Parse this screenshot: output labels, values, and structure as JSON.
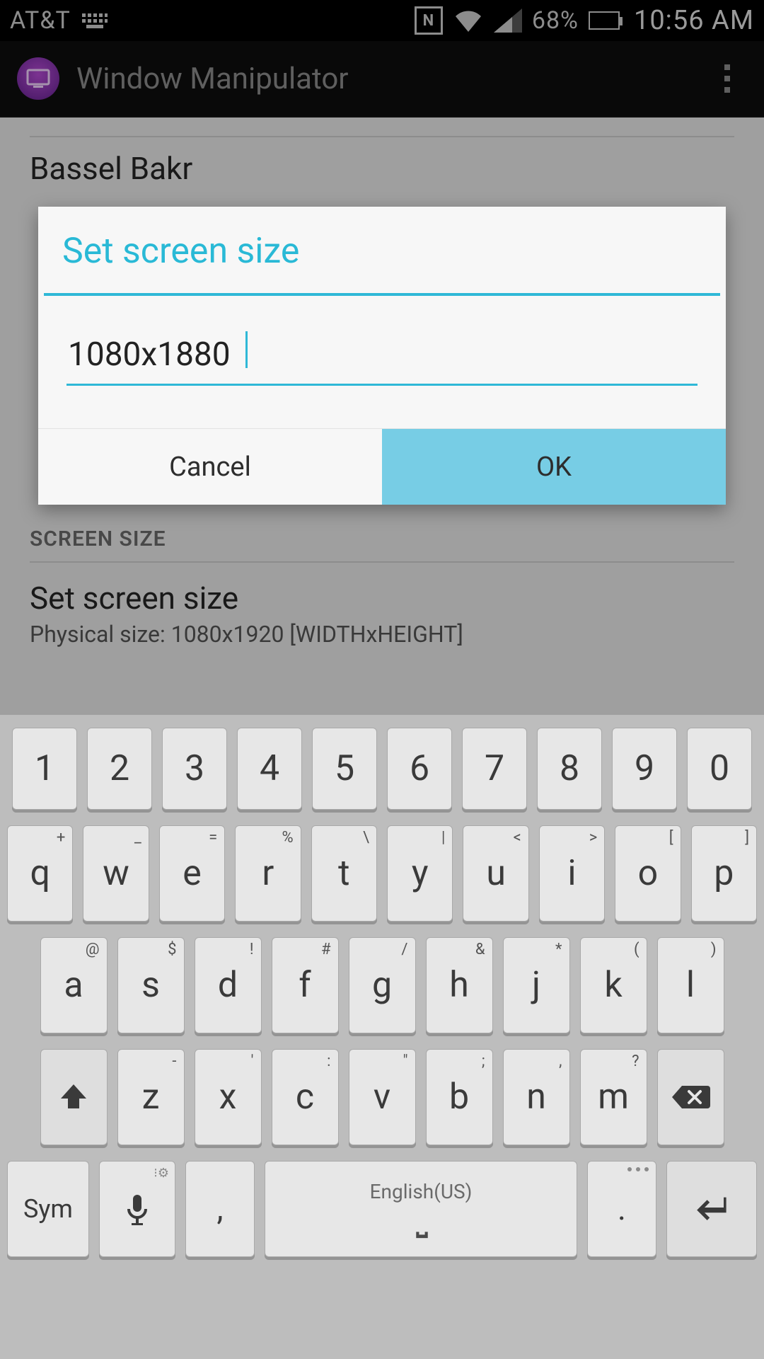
{
  "statusbar": {
    "carrier": "AT&T",
    "battery_pct": "68%",
    "clock": "10:56 AM"
  },
  "actionbar": {
    "title": "Window Manipulator"
  },
  "bg": {
    "author": "Bassel Bakr",
    "section": "SCREEN SIZE",
    "item_title": "Set screen size",
    "item_sub": "Physical size: 1080x1920 [WIDTHxHEIGHT]"
  },
  "dialog": {
    "title": "Set screen size",
    "value": "1080x1880",
    "cancel": "Cancel",
    "ok": "OK"
  },
  "kbd": {
    "nums": [
      "1",
      "2",
      "3",
      "4",
      "5",
      "6",
      "7",
      "8",
      "9",
      "0"
    ],
    "row1_main": [
      "q",
      "w",
      "e",
      "r",
      "t",
      "y",
      "u",
      "i",
      "o",
      "p"
    ],
    "row1_sup": [
      "+",
      "_",
      "=",
      "%",
      "\\",
      "|",
      "<",
      ">",
      "[",
      "]"
    ],
    "row2_main": [
      "a",
      "s",
      "d",
      "f",
      "g",
      "h",
      "j",
      "k",
      "l"
    ],
    "row2_sup": [
      "@",
      "$",
      "!",
      "#",
      "/",
      "&",
      "*",
      "(",
      ")"
    ],
    "row3_main": [
      "z",
      "x",
      "c",
      "v",
      "b",
      "n",
      "m"
    ],
    "row3_sup": [
      "-",
      "'",
      ":",
      "\"",
      ";",
      ",",
      "?"
    ],
    "sym": "Sym",
    "comma": ",",
    "space_lang": "English(US)",
    "dot": "."
  }
}
